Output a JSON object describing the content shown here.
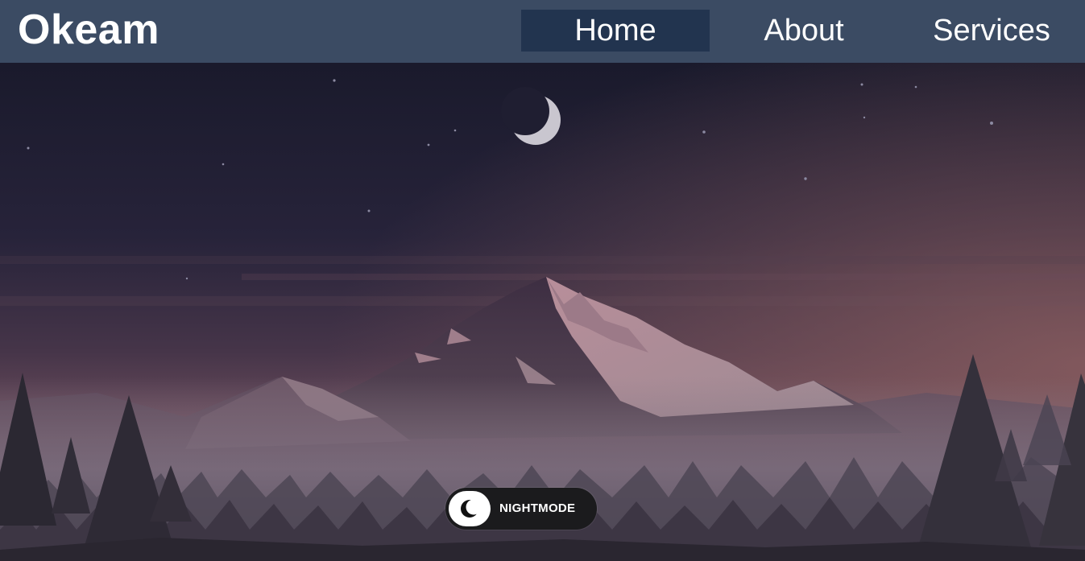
{
  "brand": {
    "name": "Okeam"
  },
  "nav": {
    "items": [
      {
        "label": "Home",
        "active": true
      },
      {
        "label": "About",
        "active": false
      },
      {
        "label": "Services",
        "active": false
      }
    ]
  },
  "hero": {
    "scene": "night-mountain-landscape",
    "icons": [
      "moon-icon",
      "mountain-illustration",
      "pine-tree-icon"
    ]
  },
  "toggle": {
    "label": "NIGHTMODE",
    "icon": "crescent-moon-icon",
    "state": "on"
  },
  "colors": {
    "navbar": "#3b4b63",
    "nav_active": "#22344f",
    "sky_top": "#1a1a2c",
    "sky_glow": "#7a5260",
    "toggle_bg": "#1b1b1d"
  }
}
